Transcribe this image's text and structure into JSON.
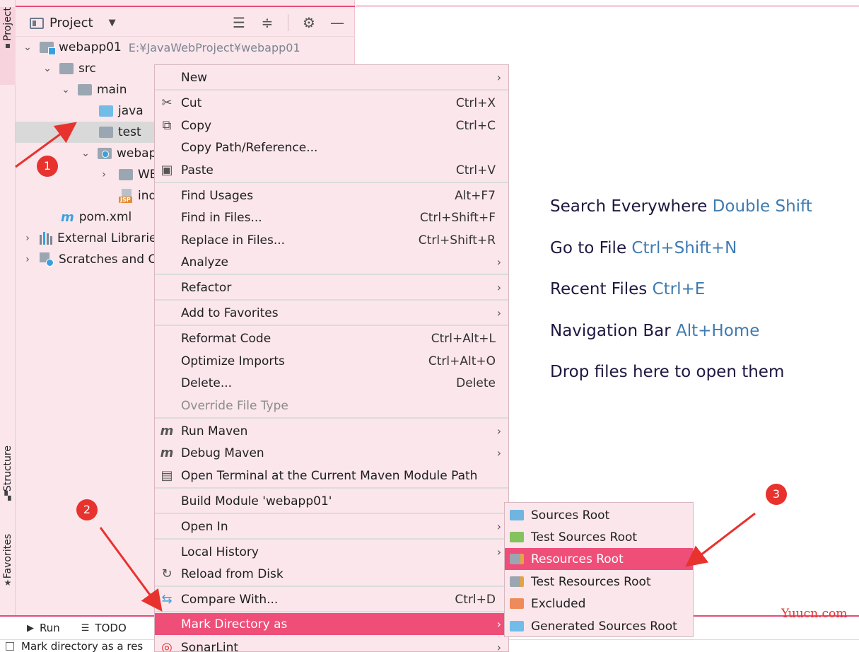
{
  "side_strip": {
    "tabs": [
      "Project",
      "Structure",
      "Favorites"
    ]
  },
  "project_panel": {
    "title": "Project",
    "header_icons": [
      "expand-all-icon",
      "collapse-all-icon",
      "gear-icon",
      "minimize-icon"
    ],
    "tree": [
      {
        "label": "webapp01",
        "path": "E:¥JavaWebProject¥webapp01"
      },
      {
        "label": "src"
      },
      {
        "label": "main"
      },
      {
        "label": "java"
      },
      {
        "label": "test"
      },
      {
        "label": "webap"
      },
      {
        "label": "WE"
      },
      {
        "label": "ind"
      },
      {
        "label": "pom.xml"
      },
      {
        "label": "External Librarie"
      },
      {
        "label": "Scratches and C"
      }
    ]
  },
  "editor_hints": [
    {
      "text": "Search Everywhere",
      "key": "Double Shift"
    },
    {
      "text": "Go to File",
      "key": "Ctrl+Shift+N"
    },
    {
      "text": "Recent Files",
      "key": "Ctrl+E"
    },
    {
      "text": "Navigation Bar",
      "key": "Alt+Home"
    },
    {
      "text": "Drop files here to open them",
      "key": ""
    }
  ],
  "context_menu": {
    "items": [
      {
        "label": "New",
        "shortcut": ""
      },
      {
        "label": "Cut",
        "shortcut": "Ctrl+X"
      },
      {
        "label": "Copy",
        "shortcut": "Ctrl+C"
      },
      {
        "label": "Copy Path/Reference...",
        "shortcut": ""
      },
      {
        "label": "Paste",
        "shortcut": "Ctrl+V"
      },
      {
        "label": "Find Usages",
        "shortcut": "Alt+F7"
      },
      {
        "label": "Find in Files...",
        "shortcut": "Ctrl+Shift+F"
      },
      {
        "label": "Replace in Files...",
        "shortcut": "Ctrl+Shift+R"
      },
      {
        "label": "Analyze",
        "shortcut": ""
      },
      {
        "label": "Refactor",
        "shortcut": ""
      },
      {
        "label": "Add to Favorites",
        "shortcut": ""
      },
      {
        "label": "Reformat Code",
        "shortcut": "Ctrl+Alt+L"
      },
      {
        "label": "Optimize Imports",
        "shortcut": "Ctrl+Alt+O"
      },
      {
        "label": "Delete...",
        "shortcut": "Delete"
      },
      {
        "label": "Override File Type",
        "shortcut": ""
      },
      {
        "label": "Run Maven",
        "shortcut": ""
      },
      {
        "label": "Debug Maven",
        "shortcut": ""
      },
      {
        "label": "Open Terminal at the Current Maven Module Path",
        "shortcut": ""
      },
      {
        "label": "Build Module 'webapp01'",
        "shortcut": ""
      },
      {
        "label": "Open In",
        "shortcut": ""
      },
      {
        "label": "Local History",
        "shortcut": ""
      },
      {
        "label": "Reload from Disk",
        "shortcut": ""
      },
      {
        "label": "Compare With...",
        "shortcut": "Ctrl+D"
      },
      {
        "label": "Mark Directory as",
        "shortcut": ""
      },
      {
        "label": "SonarLint",
        "shortcut": ""
      }
    ]
  },
  "submenu": {
    "items": [
      {
        "label": "Sources Root",
        "color": "#6fb5e0"
      },
      {
        "label": "Test Sources Root",
        "color": "#84c25e"
      },
      {
        "label": "Resources Root",
        "color": "#9aa7b2"
      },
      {
        "label": "Test Resources Root",
        "color": "#9aa7b2"
      },
      {
        "label": "Excluded",
        "color": "#ef8b5a"
      },
      {
        "label": "Generated Sources Root",
        "color": "#72bde8"
      }
    ]
  },
  "bottom_tabs": [
    {
      "label": "Run",
      "icon": "play-icon"
    },
    {
      "label": "TODO",
      "icon": "list-icon"
    }
  ],
  "status": {
    "text": "Mark directory as a res"
  },
  "annotations": {
    "badges": [
      "1",
      "2",
      "3"
    ],
    "watermark": "Yuucn.com"
  },
  "colors": {
    "accent": "#ef4e79",
    "panel_bg": "#fbe6ec",
    "hint_key": "#3f7bb0",
    "annotation_red": "#e8322e"
  }
}
